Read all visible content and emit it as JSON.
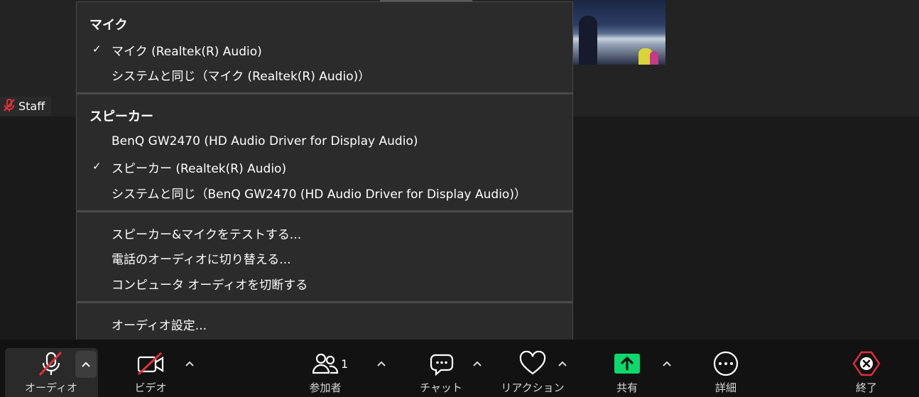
{
  "video": {
    "participant_name": "Staff"
  },
  "menu": {
    "mic_header": "マイク",
    "mic_items": [
      {
        "label": "マイク (Realtek(R) Audio)",
        "checked": true
      },
      {
        "label": "システムと同じ（マイク (Realtek(R) Audio)）",
        "checked": false
      }
    ],
    "speaker_header": "スピーカー",
    "speaker_items": [
      {
        "label": "BenQ GW2470 (HD Audio Driver for Display Audio)",
        "checked": false
      },
      {
        "label": "スピーカー (Realtek(R) Audio)",
        "checked": true
      },
      {
        "label": "システムと同じ（BenQ GW2470 (HD Audio Driver for Display Audio)）",
        "checked": false
      }
    ],
    "actions": [
      {
        "label": "スピーカー&マイクをテストする..."
      },
      {
        "label": "電話のオーディオに切り替える..."
      },
      {
        "label": "コンピュータ オーディオを切断する"
      }
    ],
    "settings_label": "オーディオ設定...",
    "check_glyph": "✓"
  },
  "toolbar": {
    "audio_label": "オーディオ",
    "video_label": "ビデオ",
    "participants_label": "参加者",
    "participants_count": "1",
    "chat_label": "チャット",
    "reactions_label": "リアクション",
    "share_label": "共有",
    "more_label": "詳細",
    "end_label": "終了",
    "caret_glyph": "⌃"
  },
  "colors": {
    "menu_bg": "#2b2b2b",
    "toolbar_bg": "#121212",
    "muted_red": "#e0303a",
    "share_green": "#0bd96b",
    "end_red": "#e0303a"
  },
  "icons": {
    "mic": "mic-muted-icon",
    "camera": "camera-off-icon",
    "participants": "people-icon",
    "chat": "chat-bubble-icon",
    "reactions": "heart-icon",
    "share": "share-up-arrow-icon",
    "more": "ellipsis-circle-icon",
    "end": "end-x-hexagon-icon"
  }
}
